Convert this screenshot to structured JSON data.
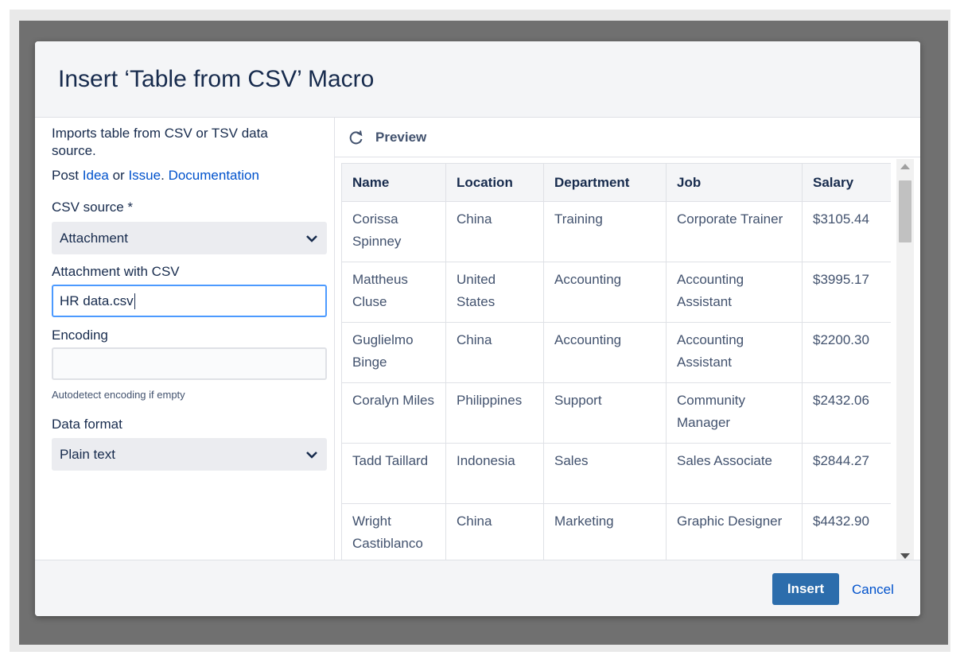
{
  "dialog": {
    "title": "Insert ‘Table from CSV’ Macro"
  },
  "left": {
    "description": "Imports table from CSV or TSV data source.",
    "links": {
      "post": "Post",
      "idea": "Idea",
      "or": "or",
      "issue": "Issue",
      "dot": ".",
      "documentation": "Documentation"
    },
    "csv_source": {
      "label": "CSV source *",
      "value": "Attachment"
    },
    "attachment": {
      "label": "Attachment with CSV",
      "value": "HR data.csv"
    },
    "encoding": {
      "label": "Encoding",
      "value": "",
      "help": "Autodetect encoding if empty"
    },
    "data_format": {
      "label": "Data format",
      "value": "Plain text"
    }
  },
  "preview": {
    "label": "Preview",
    "columns": [
      "Name",
      "Location",
      "Department",
      "Job",
      "Salary"
    ],
    "rows": [
      [
        "Corissa Spinney",
        "China",
        "Training",
        "Corporate Trainer",
        "$3105.44"
      ],
      [
        "Mattheus Cluse",
        "United States",
        "Accounting",
        "Accounting Assistant",
        "$3995.17"
      ],
      [
        "Guglielmo Binge",
        "China",
        "Accounting",
        "Accounting Assistant",
        "$2200.30"
      ],
      [
        "Coralyn Miles",
        "Philippines",
        "Support",
        "Community Manager",
        "$2432.06"
      ],
      [
        "Tadd Taillard",
        "Indonesia",
        "Sales",
        "Sales Associate",
        "$2844.27"
      ],
      [
        "Wright Castiblanco",
        "China",
        "Marketing",
        "Graphic Designer",
        "$4432.90"
      ]
    ]
  },
  "footer": {
    "insert": "Insert",
    "cancel": "Cancel"
  },
  "colors": {
    "primary": "#2c6dac",
    "link": "#0052cc",
    "text": "#172b4d",
    "overlay": "#707070"
  }
}
